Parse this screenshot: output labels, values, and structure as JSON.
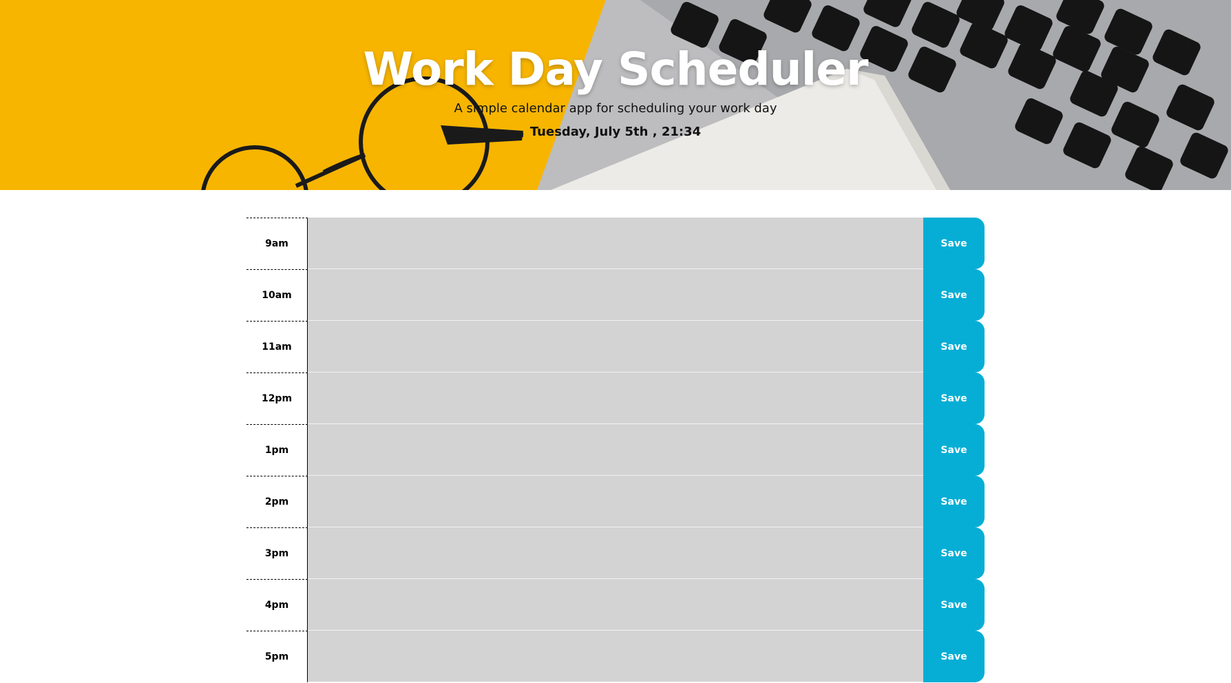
{
  "header": {
    "title": "Work Day Scheduler",
    "subtitle": "A simple calendar app for scheduling your work day",
    "datetime": "Tuesday, July 5th , 21:34"
  },
  "colors": {
    "hero_yellow": "#f7b500",
    "row_fill": "#d3d3d3",
    "save_button": "#06aed5"
  },
  "schedule": {
    "rows": [
      {
        "hour": "9am",
        "text": "",
        "save_label": "Save"
      },
      {
        "hour": "10am",
        "text": "",
        "save_label": "Save"
      },
      {
        "hour": "11am",
        "text": "",
        "save_label": "Save"
      },
      {
        "hour": "12pm",
        "text": "",
        "save_label": "Save"
      },
      {
        "hour": "1pm",
        "text": "",
        "save_label": "Save"
      },
      {
        "hour": "2pm",
        "text": "",
        "save_label": "Save"
      },
      {
        "hour": "3pm",
        "text": "",
        "save_label": "Save"
      },
      {
        "hour": "4pm",
        "text": "",
        "save_label": "Save"
      },
      {
        "hour": "5pm",
        "text": "",
        "save_label": "Save"
      }
    ]
  }
}
